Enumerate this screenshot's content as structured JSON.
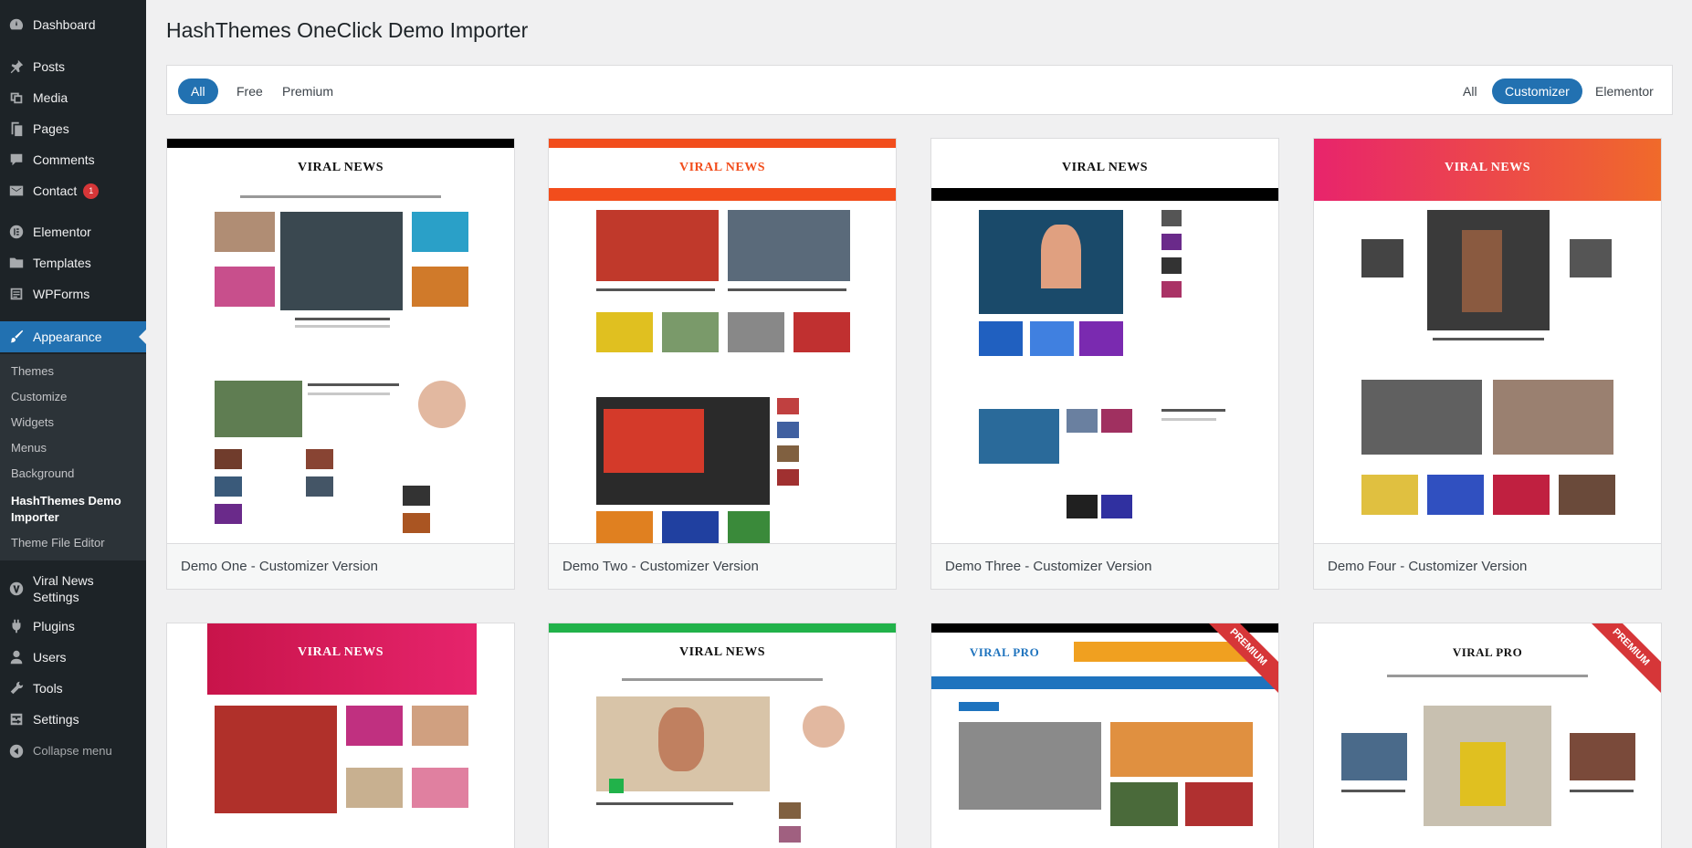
{
  "sidebar": {
    "items": [
      {
        "label": "Dashboard",
        "icon": "dashboard-icon"
      },
      {
        "label": "Posts",
        "icon": "pin-icon"
      },
      {
        "label": "Media",
        "icon": "media-icon"
      },
      {
        "label": "Pages",
        "icon": "pages-icon"
      },
      {
        "label": "Comments",
        "icon": "comment-icon"
      },
      {
        "label": "Contact",
        "icon": "mail-icon",
        "badge": "1"
      },
      {
        "label": "Elementor",
        "icon": "elementor-icon"
      },
      {
        "label": "Templates",
        "icon": "folder-icon"
      },
      {
        "label": "WPForms",
        "icon": "form-icon"
      },
      {
        "label": "Appearance",
        "icon": "brush-icon"
      },
      {
        "label": "Viral News Settings",
        "icon": "viral-icon"
      },
      {
        "label": "Plugins",
        "icon": "plugin-icon"
      },
      {
        "label": "Users",
        "icon": "user-icon"
      },
      {
        "label": "Tools",
        "icon": "wrench-icon"
      },
      {
        "label": "Settings",
        "icon": "settings-icon"
      },
      {
        "label": "Collapse menu",
        "icon": "collapse-icon"
      }
    ],
    "appearance_submenu": [
      "Themes",
      "Customize",
      "Widgets",
      "Menus",
      "Background",
      "HashThemes Demo Importer",
      "Theme File Editor"
    ]
  },
  "page": {
    "title": "HashThemes OneClick Demo Importer"
  },
  "filters": {
    "type": [
      "All",
      "Free",
      "Premium"
    ],
    "type_selected": "All",
    "builder": [
      "All",
      "Customizer",
      "Elementor"
    ],
    "builder_selected": "Customizer"
  },
  "demos": [
    {
      "name": "Demo One - Customizer Version",
      "logo": "VIRAL NEWS",
      "theme_color": "#000000",
      "premium": false
    },
    {
      "name": "Demo Two - Customizer Version",
      "logo": "VIRAL NEWS",
      "theme_color": "#f24d1c",
      "premium": false
    },
    {
      "name": "Demo Three - Customizer Version",
      "logo": "VIRAL NEWS",
      "theme_color": "#000000",
      "premium": false
    },
    {
      "name": "Demo Four - Customizer Version",
      "logo": "VIRAL NEWS",
      "theme_color": "#e8246c",
      "premium": false
    },
    {
      "name": "",
      "logo": "VIRAL NEWS",
      "theme_color": "#d81b5a",
      "premium": false
    },
    {
      "name": "",
      "logo": "VIRAL NEWS",
      "theme_color": "#21b24a",
      "premium": false
    },
    {
      "name": "",
      "logo": "VIRAL PRO",
      "theme_color": "#1e73be",
      "premium": true,
      "ribbon": "PREMIUM"
    },
    {
      "name": "",
      "logo": "VIRAL PRO",
      "theme_color": "#d63638",
      "premium": true,
      "ribbon": "PREMIUM"
    }
  ],
  "colors": {
    "sidebar_bg": "#1d2327",
    "submenu_bg": "#2c3338",
    "accent": "#2271b1",
    "badge": "#d63638"
  }
}
